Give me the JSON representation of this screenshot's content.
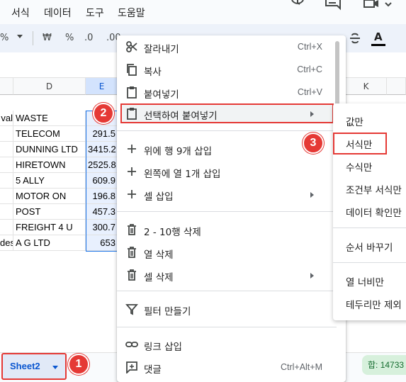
{
  "menubar": {
    "items": [
      "서식",
      "데이터",
      "도구",
      "도움말"
    ]
  },
  "toolbar": {
    "percent": "%",
    "won": "₩",
    "pct2": "%",
    "dec_minus": ".0",
    "dec_plus": ".00",
    "font_color": "A"
  },
  "columns": {
    "d": "D",
    "e": "E",
    "k": "K"
  },
  "cells": {
    "c_partial": [
      "val",
      "",
      "",
      "",
      "",
      "",
      "",
      "",
      "des"
    ],
    "d": [
      "WASTE",
      "TELECOM",
      "DUNNING LTD",
      "HIRETOWN",
      "5 ALLY",
      "MOTOR ON",
      "POST",
      "FREIGHT 4 U",
      "A G LTD"
    ],
    "e": [
      "",
      "291.5",
      "3415.2",
      "2525.8",
      "609.9",
      "196.8",
      "457.3",
      "300.7",
      "653"
    ]
  },
  "context_menu": {
    "items": [
      {
        "label": "잘라내기",
        "shortcut": "Ctrl+X",
        "icon": "scissors-icon"
      },
      {
        "label": "복사",
        "shortcut": "Ctrl+C",
        "icon": "copy-icon"
      },
      {
        "label": "붙여넣기",
        "shortcut": "Ctrl+V",
        "icon": "clipboard-icon"
      },
      {
        "label": "선택하여 붙여넣기",
        "shortcut": "",
        "icon": "clipboard-icon"
      },
      {
        "label": "위에 행 9개 삽입",
        "shortcut": "",
        "icon": "plus-icon"
      },
      {
        "label": "왼쪽에 열 1개 삽입",
        "shortcut": "",
        "icon": "plus-icon"
      },
      {
        "label": "셀 삽입",
        "shortcut": "",
        "icon": "plus-icon"
      },
      {
        "label": "2 - 10행 삭제",
        "shortcut": "",
        "icon": "trash-icon"
      },
      {
        "label": "열 삭제",
        "shortcut": "",
        "icon": "trash-icon"
      },
      {
        "label": "셀 삭제",
        "shortcut": "",
        "icon": "trash-icon"
      },
      {
        "label": "필터 만들기",
        "shortcut": "",
        "icon": "filter-icon"
      },
      {
        "label": "링크 삽입",
        "shortcut": "",
        "icon": "link-icon"
      },
      {
        "label": "댓글",
        "shortcut": "Ctrl+Alt+M",
        "icon": "comment-add-icon"
      }
    ]
  },
  "submenu": {
    "items": [
      "값만",
      "서식만",
      "수식만",
      "조건부 서식만",
      "데이터 확인만",
      "순서 바꾸기",
      "열 너비만",
      "테두리만 제외"
    ]
  },
  "bottom": {
    "sheet_name": "Sheet2",
    "sum": "합: 14733"
  },
  "badges": [
    "1",
    "2",
    "3"
  ],
  "colors": {
    "highlight": "#e53935",
    "accent": "#0b57d0",
    "selection": "#e8f0fe"
  }
}
